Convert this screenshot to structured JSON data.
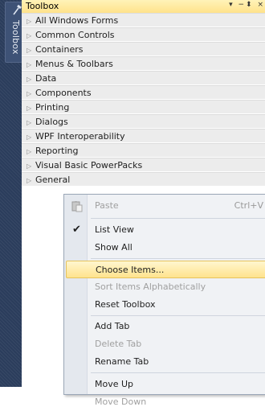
{
  "strip": {
    "label": "Toolbox",
    "icon": "hammer-wrench-icon"
  },
  "toolbox": {
    "title": "Toolbox",
    "controls": "▾ −⬍ ×",
    "categories": [
      "All Windows Forms",
      "Common Controls",
      "Containers",
      "Menus & Toolbars",
      "Data",
      "Components",
      "Printing",
      "Dialogs",
      "WPF Interoperability",
      "Reporting",
      "Visual Basic PowerPacks",
      "General"
    ]
  },
  "context_menu": {
    "items": [
      {
        "label": "Paste",
        "shortcut": "Ctrl+V",
        "disabled": true,
        "icon": "clipboard-paste-icon"
      },
      {
        "label": "List View",
        "checked": true
      },
      {
        "label": "Show All"
      },
      {
        "label": "Choose Items...",
        "highlighted": true
      },
      {
        "label": "Sort Items Alphabetically",
        "disabled": true
      },
      {
        "label": "Reset Toolbox"
      },
      {
        "label": "Add Tab"
      },
      {
        "label": "Delete Tab",
        "disabled": true
      },
      {
        "label": "Rename Tab"
      },
      {
        "label": "Move Up"
      },
      {
        "label": "Move Down",
        "disabled": true
      }
    ],
    "check_glyph": "✔"
  },
  "colors": {
    "strip_bg": "#2b3d5c",
    "title_bg": "#ffe28b",
    "highlight": "#ffe38d"
  }
}
